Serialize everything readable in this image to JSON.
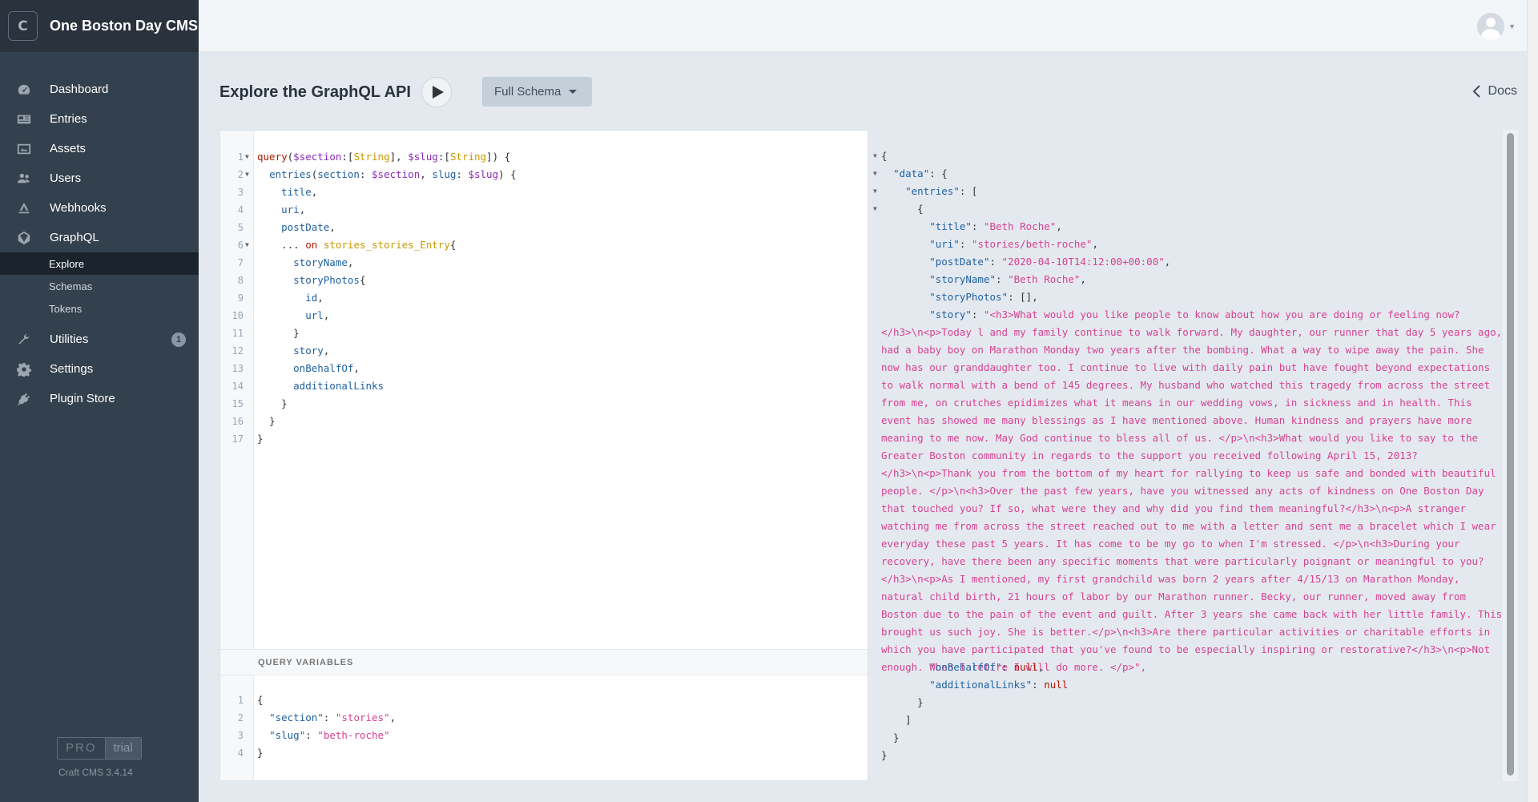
{
  "site": {
    "logo_letter": "C",
    "name": "One Boston Day CMS"
  },
  "nav": {
    "items": [
      {
        "label": "Dashboard",
        "icon": "gauge-icon"
      },
      {
        "label": "Entries",
        "icon": "newspaper-icon"
      },
      {
        "label": "Assets",
        "icon": "image-icon"
      },
      {
        "label": "Users",
        "icon": "users-icon"
      },
      {
        "label": "Webhooks",
        "icon": "webhook-icon"
      },
      {
        "label": "GraphQL",
        "icon": "graphql-icon"
      }
    ],
    "graphql_sub": [
      {
        "label": "Explore",
        "active": true
      },
      {
        "label": "Schemas"
      },
      {
        "label": "Tokens"
      }
    ],
    "utilities": {
      "label": "Utilities",
      "badge": "1",
      "icon": "wrench-icon"
    },
    "settings": {
      "label": "Settings",
      "icon": "gear-icon"
    },
    "plugin_store": {
      "label": "Plugin Store",
      "icon": "plug-icon"
    }
  },
  "edition": {
    "pro": "PRO",
    "trial": "trial",
    "version": "Craft CMS 3.4.14"
  },
  "page": {
    "title": "Explore the GraphQL API",
    "schema_label": "Full Schema",
    "docs_label": "Docs"
  },
  "query_variables_header": "QUERY VARIABLES",
  "result": {
    "title": "Beth Roche",
    "uri": "stories/beth-roche",
    "postDate": "2020-04-10T14:12:00+00:00",
    "storyName": "Beth Roche",
    "storyPhotos": "[]",
    "story": "\"<h3>What would you like people to know about how you are doing or feeling now?</h3>\\n<p>Today l and my family continue to walk forward. My daughter, our runner that day 5 years ago, had a baby boy on Marathon Monday two years after the bombing. What a way to wipe away the pain. She now has our granddaughter too. I continue to live with daily pain but have fought beyond expectations to walk normal with a bend of 145 degrees. My husband who watched this tragedy from across the street from me, on crutches epidimizes what it means in our wedding vows, in sickness and in health. This event has showed me many blessings as I have mentioned above. Human kindness and prayers have more meaning to me now. May God continue to bless all of us. </p>\\n<h3>What would you like to say to the Greater Boston community in regards to the support you received following April 15, 2013?</h3>\\n<p>Thank you from the bottom of my heart for rallying to keep us safe and bonded with beautiful people. </p>\\n<h3>Over the past few years, have you witnessed any acts of kindness on One Boston Day that touched you? If so, what were they and why did you find them meaningful?</h3>\\n<p>A stranger watching me from across the street reached out to me with a letter and sent me a bracelet which I wear everyday these past 5 years. It has come to be my go to when I'm stressed. </p>\\n<h3>During your recovery, have there been any specific moments that were particularly poignant or meaningful to you?</h3>\\n<p>As I mentioned, my first grandchild was born 2 years after 4/15/13 on Marathon Monday, natural child birth, 21 hours of labor by our Marathon runner. Becky, our runner, moved away from Boston due to the pain of the event and guilt. After 3 years she came back with her little family. This brought us such joy. She is better.</p>\\n<h3>Are there particular activities or charitable efforts in which you have participated that you've found to be especially inspiring or restorative?</h3>\\n<p>Not enough. When I retire I will do more. </p>\",",
    "onBehalfOf": "null",
    "additionalLinks": "null"
  },
  "variables": {
    "section": "stories",
    "slug": "beth-roche"
  }
}
